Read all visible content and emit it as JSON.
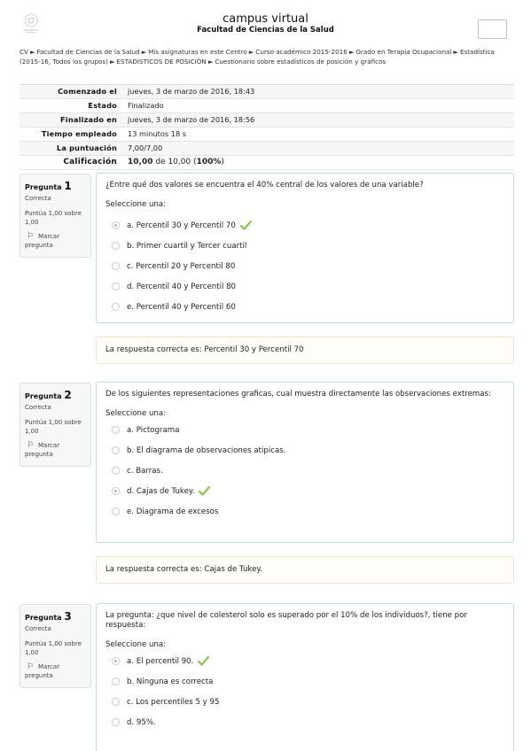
{
  "site": {
    "title": "campus virtual",
    "subtitle": "Facultad de Ciencias de la Salud"
  },
  "breadcrumb": [
    "CV",
    "Facultad de Ciencias de la Salud",
    "Mis asignaturas en este Centro",
    "Curso académico 2015-2016",
    "Grado en Terapia Ocupacional",
    "Estadística (2015-16, Todos los grupos)",
    "ESTADÍSTICOS DE POSICIÓN",
    "Cuestionario sobre estadísticos de posición y gráficos"
  ],
  "summary": [
    {
      "label": "Comenzado el",
      "value": "jueves, 3 de marzo de 2016, 18:43"
    },
    {
      "label": "Estado",
      "value": "Finalizado"
    },
    {
      "label": "Finalizado en",
      "value": "jueves, 3 de marzo de 2016, 18:56"
    },
    {
      "label": "Tiempo empleado",
      "value": "13 minutos 18 s"
    },
    {
      "label": "La puntuación",
      "value": "7,00/7,00"
    },
    {
      "label": "Calificación",
      "value_bold": "10,00",
      "value_mid": " de 10,00 (",
      "value_pct": "100%",
      "value_end": ")"
    }
  ],
  "questions": [
    {
      "prefix": "Pregunta",
      "number": "1",
      "state": "Correcta",
      "grade": "Puntúa 1,00 sobre 1,00",
      "flag": "Marcar pregunta",
      "text": "¿Entre qué dos valores se encuentra el 40% central de los valores de una variable?",
      "prompt": "Seleccione una:",
      "options": [
        {
          "label": "a. Percentil 30 y Percentil 70",
          "selected": true,
          "correct": true
        },
        {
          "label": "b. Primer cuartil y Tercer cuartil",
          "selected": false,
          "correct": false
        },
        {
          "label": "c. Percentil 20 y Percentil 80",
          "selected": false,
          "correct": false
        },
        {
          "label": "d. Percentil 40 y Percentil 80",
          "selected": false,
          "correct": false
        },
        {
          "label": "e. Percentil 40 y Percentil 60",
          "selected": false,
          "correct": false
        }
      ],
      "feedback": "La respuesta correcta es: Percentil 30 y Percentil 70"
    },
    {
      "prefix": "Pregunta",
      "number": "2",
      "state": "Correcta",
      "grade": "Puntúa 1,00 sobre 1,00",
      "flag": "Marcar pregunta",
      "text": "De los siguientes representaciones graficas, cual muestra directamente las observaciones extremas:",
      "prompt": "Seleccione una:",
      "options": [
        {
          "label": "a. Pictograma",
          "selected": false,
          "correct": false
        },
        {
          "label": "b. El diagrama de observaciones atipicas.",
          "selected": false,
          "correct": false
        },
        {
          "label": "c. Barras.",
          "selected": false,
          "correct": false
        },
        {
          "label": "d. Cajas de Tukey.",
          "selected": true,
          "correct": true
        },
        {
          "label": "e. Diagrama de excesos",
          "selected": false,
          "correct": false
        }
      ],
      "feedback": "La respuesta correcta es: Cajas de Tukey."
    },
    {
      "prefix": "Pregunta",
      "number": "3",
      "state": "Correcta",
      "grade": "Puntúa 1,00 sobre 1,00",
      "flag": "Marcar pregunta",
      "text": "La pregunta: ¿que nivel de colesterol solo es superado por el 10% de los individuos?, tiene por respuesta:",
      "prompt": "Seleccione una:",
      "options": [
        {
          "label": "a. El percentil 90.",
          "selected": true,
          "correct": true
        },
        {
          "label": "b. Ninguna es correcta",
          "selected": false,
          "correct": false
        },
        {
          "label": "c. Los percentiles 5 y 95",
          "selected": false,
          "correct": false
        },
        {
          "label": "d. 95%.",
          "selected": false,
          "correct": false
        }
      ],
      "feedback": ""
    }
  ],
  "icons": {
    "logo": "university-seal-icon",
    "check": "check-icon",
    "flag": "flag-icon",
    "separator": "triangle-right-icon"
  },
  "colors": {
    "formulation_border": "#bcdcef",
    "feedback_border": "#f5e3c8",
    "check_green": "#7cc341"
  }
}
